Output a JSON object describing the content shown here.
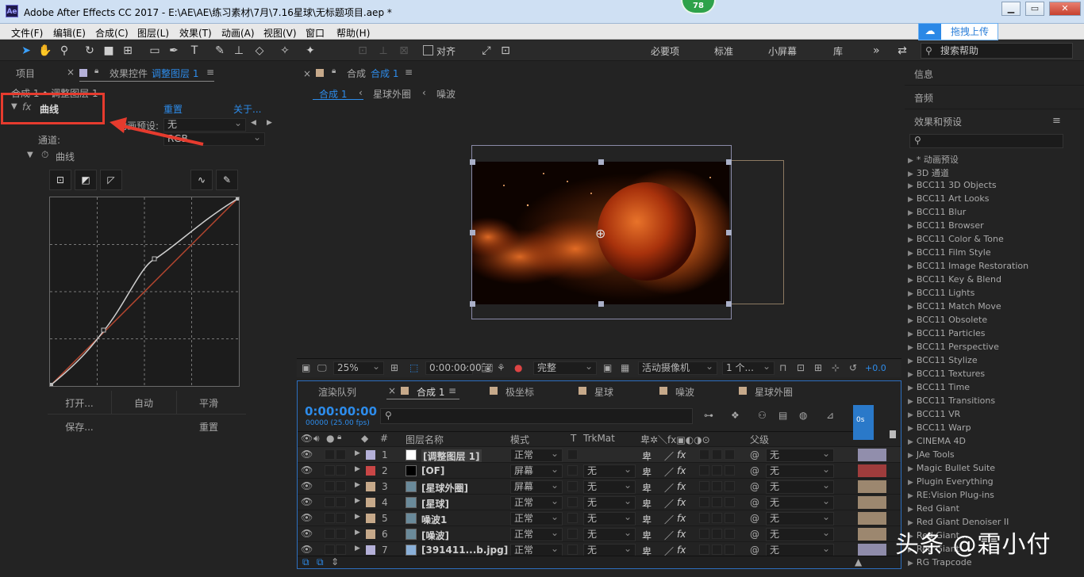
{
  "window": {
    "title": "Adobe After Effects CC 2017 - E:\\AE\\AE\\练习素材\\7月\\7.16星球\\无标题项目.aep *",
    "badge": "78",
    "app_icon": "Ae"
  },
  "menu": [
    "文件(F)",
    "编辑(E)",
    "合成(C)",
    "图层(L)",
    "效果(T)",
    "动画(A)",
    "视图(V)",
    "窗口",
    "帮助(H)"
  ],
  "upload_button": "拖拽上传",
  "toolbar": {
    "align_label": "对齐",
    "workspaces": [
      "必要项",
      "标准",
      "小屏幕",
      "库"
    ],
    "more": "»",
    "search_placeholder": "搜索帮助"
  },
  "left_panel": {
    "tab_project": "项目",
    "tab_effects": "效果控件",
    "tab_effects_layer": "调整图层 1",
    "breadcrumb": "合成 1 • 调整图层 1",
    "effect_name": "曲线",
    "reset": "重置",
    "about": "关于...",
    "preset_label": "动画预设:",
    "preset_value": "无",
    "channel_label": "通道:",
    "channel_value": "RGB",
    "curves_label": "曲线",
    "buttons": {
      "open": "打开...",
      "auto": "自动",
      "smooth": "平滑",
      "save": "保存...",
      "reset": "重置"
    }
  },
  "viewer": {
    "tab_label": "合成",
    "tab_name": "合成 1",
    "crumbs": [
      "合成 1",
      "星球外圈",
      "噪波"
    ],
    "zoom": "25%",
    "timecode": "0:00:00:00",
    "resolution": "完整",
    "camera": "活动摄像机",
    "views": "1 个...",
    "exposure": "+0.0"
  },
  "timeline": {
    "tabs": [
      "渲染队列",
      "合成 1",
      "极坐标",
      "星球",
      "噪波",
      "星球外圈"
    ],
    "timecode": "0:00:00:00",
    "fps": "00000 (25.00 fps)",
    "ruler_label": "0s",
    "headers": {
      "num": "#",
      "name": "图层名称",
      "mode": "模式",
      "t": "T",
      "trkmat": "TrkMat",
      "parent": "父级"
    },
    "layers": [
      {
        "num": "1",
        "name": "[调整图层 1]",
        "mode": "正常",
        "trkmat": "",
        "parent": "无",
        "label_color": "#b4b0d8",
        "thumb_color": "#ffffff"
      },
      {
        "num": "2",
        "name": "[OF]",
        "mode": "屏幕",
        "trkmat": "无",
        "parent": "无",
        "label_color": "#c94646",
        "thumb_color": "#000000"
      },
      {
        "num": "3",
        "name": "[星球外圈]",
        "mode": "屏幕",
        "trkmat": "无",
        "parent": "无",
        "label_color": "#c6a98a",
        "thumb_color": "#6a8a9a"
      },
      {
        "num": "4",
        "name": "[星球]",
        "mode": "正常",
        "trkmat": "无",
        "parent": "无",
        "label_color": "#c6a98a",
        "thumb_color": "#6a8a9a"
      },
      {
        "num": "5",
        "name": "噪波1",
        "mode": "正常",
        "trkmat": "无",
        "parent": "无",
        "label_color": "#c6a98a",
        "thumb_color": "#6a8a9a"
      },
      {
        "num": "6",
        "name": "[噪波]",
        "mode": "正常",
        "trkmat": "无",
        "parent": "无",
        "label_color": "#c6a98a",
        "thumb_color": "#6a8a9a"
      },
      {
        "num": "7",
        "name": "[391411...b.jpg]",
        "mode": "正常",
        "trkmat": "无",
        "parent": "无",
        "label_color": "#b4b0d8",
        "thumb_color": "#8ab0d8"
      }
    ]
  },
  "right_panel": {
    "info": "信息",
    "audio": "音频",
    "effects_presets": "效果和预设",
    "menu_icon": "≡",
    "items": [
      "* 动画预设",
      "3D 通道",
      "BCC11 3D Objects",
      "BCC11 Art Looks",
      "BCC11 Blur",
      "BCC11 Browser",
      "BCC11 Color & Tone",
      "BCC11 Film Style",
      "BCC11 Image Restoration",
      "BCC11 Key & Blend",
      "BCC11 Lights",
      "BCC11 Match Move",
      "BCC11 Obsolete",
      "BCC11 Particles",
      "BCC11 Perspective",
      "BCC11 Stylize",
      "BCC11 Textures",
      "BCC11 Time",
      "BCC11 Transitions",
      "BCC11 VR",
      "BCC11 Warp",
      "CINEMA 4D",
      "JAe Tools",
      "Magic Bullet Suite",
      "Plugin Everything",
      "RE:Vision Plug-ins",
      "Red Giant",
      "Red Giant Denoiser II",
      "Red Giant ...",
      "Red Giant ...",
      "RG Trapcode"
    ]
  },
  "watermark": "头条 @霜小付"
}
